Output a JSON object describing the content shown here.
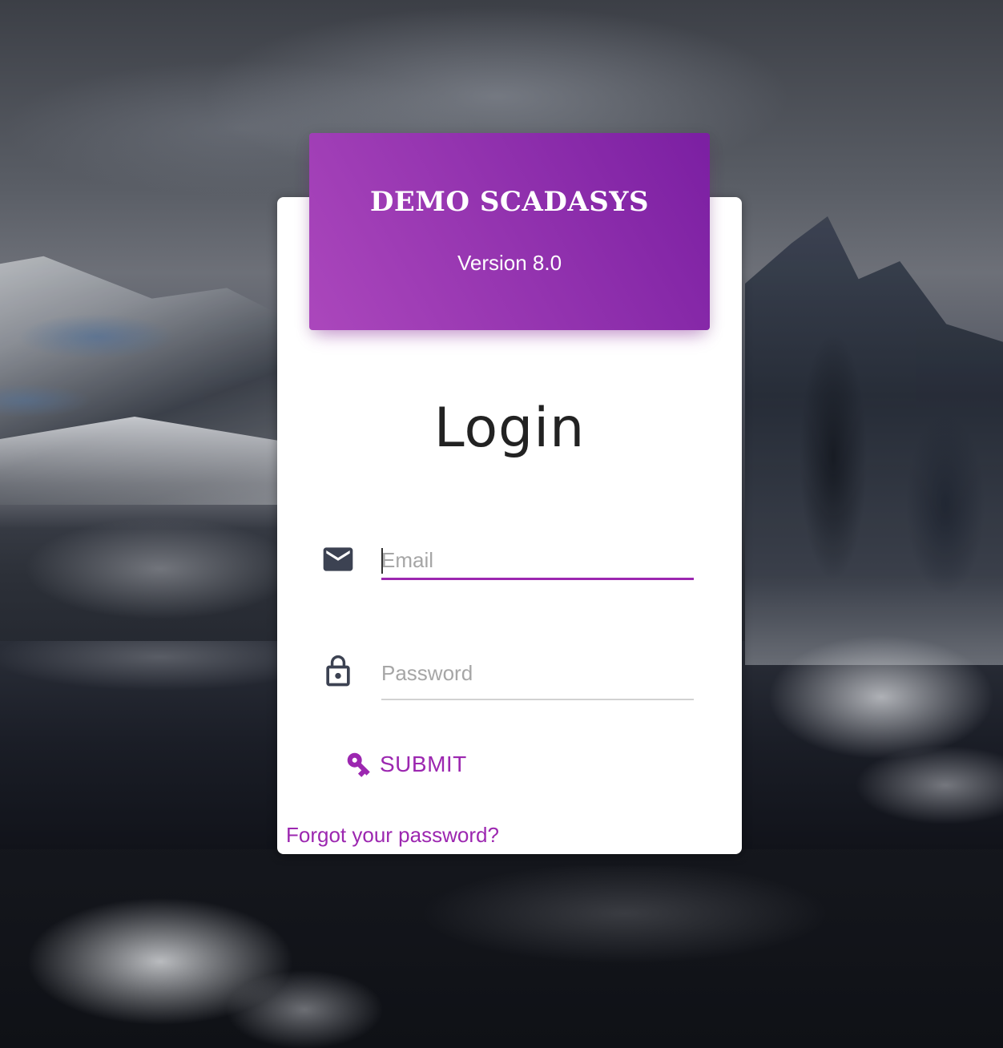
{
  "header": {
    "app_title": "DEMO SCADASYS",
    "version": "Version 8.0"
  },
  "login": {
    "title": "Login",
    "email": {
      "placeholder": "Email",
      "value": "",
      "icon": "mail-icon",
      "focused": true
    },
    "password": {
      "placeholder": "Password",
      "value": "",
      "icon": "lock-icon"
    },
    "submit": {
      "label": "SUBMIT",
      "icon": "key-icon"
    },
    "forgot_password_label": "Forgot your password?"
  },
  "colors": {
    "accent": "#9c27b0",
    "header_gradient_start": "#ab47bc",
    "header_gradient_end": "#7b1fa2",
    "icon": "#3c4252"
  }
}
